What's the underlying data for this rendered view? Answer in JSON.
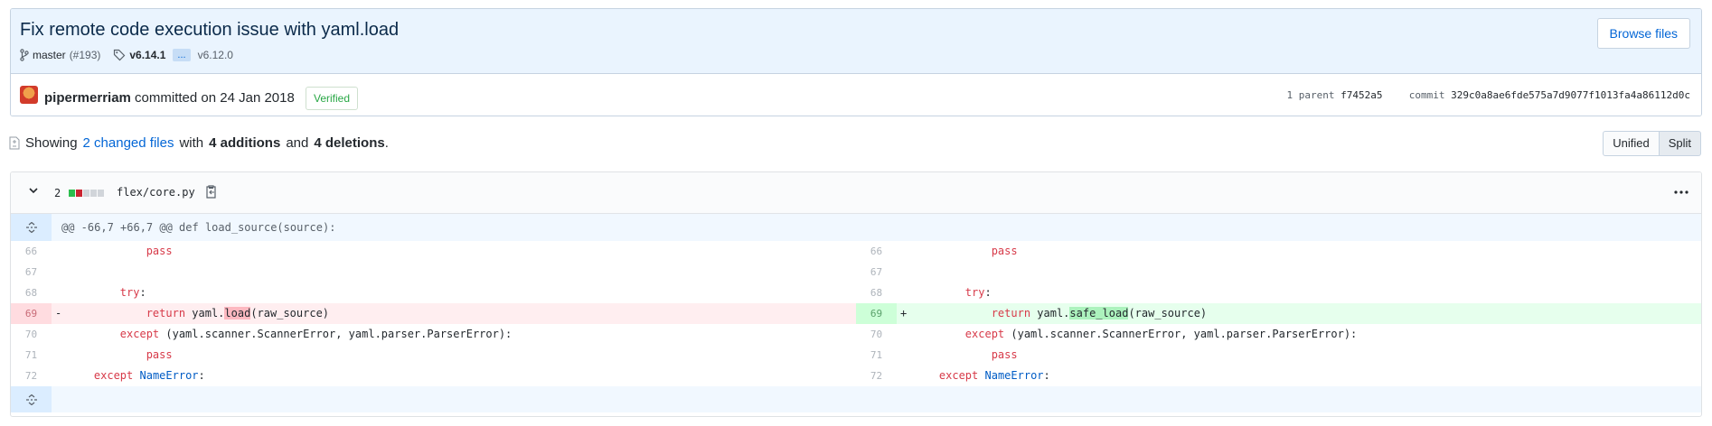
{
  "commit": {
    "title": "Fix remote code execution issue with yaml.load",
    "branch": "master",
    "pr": "(#193)",
    "tag": "v6.14.1",
    "ellipsis": "...",
    "tag_old": "v6.12.0",
    "browse_label": "Browse files",
    "author": "pipermerriam",
    "committed_text": "committed on 24 Jan 2018",
    "verified": "Verified",
    "parent_label": "1 parent",
    "parent_sha": "f7452a5",
    "commit_label": "commit",
    "commit_sha": "329c0a8ae6fde575a7d9077f1013fa4a86112d0c"
  },
  "summary": {
    "showing": "Showing",
    "changed_files": "2 changed files",
    "with": "with",
    "additions": "4 additions",
    "and": "and",
    "deletions": "4 deletions",
    "period": "."
  },
  "view_toggle": {
    "unified": "Unified",
    "split": "Split",
    "selected": "Split"
  },
  "file": {
    "changes": "2",
    "path": "flex/core.py",
    "hunk_header": "@@ -66,7 +66,7 @@ def load_source(source):",
    "colors": {
      "add": "#2cbe4e",
      "del": "#cb2431",
      "neutral": "#d1d5da"
    }
  },
  "diff": {
    "left": [
      {
        "ln": "66",
        "sign": "",
        "pre": "            ",
        "kw": "pass",
        "rest": ""
      },
      {
        "ln": "67",
        "sign": "",
        "pre": "",
        "kw": "",
        "rest": ""
      },
      {
        "ln": "68",
        "sign": "",
        "pre": "        ",
        "kw": "try",
        "rest": ":"
      },
      {
        "ln": "69",
        "sign": "-",
        "pre": "            ",
        "kw": "return",
        "rest": " yaml.",
        "hl": "load",
        "tail": "(raw_source)"
      },
      {
        "ln": "70",
        "sign": "",
        "pre": "        ",
        "kw": "except",
        "rest": " (yaml.scanner.ScannerError, yaml.parser.ParserError):"
      },
      {
        "ln": "71",
        "sign": "",
        "pre": "            ",
        "kw": "pass",
        "rest": ""
      },
      {
        "ln": "72",
        "sign": "",
        "pre": "    ",
        "kw": "except",
        "rest": " ",
        "bi": "NameError",
        "tail": ":"
      }
    ],
    "right": [
      {
        "ln": "66",
        "sign": "",
        "pre": "            ",
        "kw": "pass",
        "rest": ""
      },
      {
        "ln": "67",
        "sign": "",
        "pre": "",
        "kw": "",
        "rest": ""
      },
      {
        "ln": "68",
        "sign": "",
        "pre": "        ",
        "kw": "try",
        "rest": ":"
      },
      {
        "ln": "69",
        "sign": "+",
        "pre": "            ",
        "kw": "return",
        "rest": " yaml.",
        "hl": "safe_load",
        "tail": "(raw_source)"
      },
      {
        "ln": "70",
        "sign": "",
        "pre": "        ",
        "kw": "except",
        "rest": " (yaml.scanner.ScannerError, yaml.parser.ParserError):"
      },
      {
        "ln": "71",
        "sign": "",
        "pre": "            ",
        "kw": "pass",
        "rest": ""
      },
      {
        "ln": "72",
        "sign": "",
        "pre": "    ",
        "kw": "except",
        "rest": " ",
        "bi": "NameError",
        "tail": ":"
      }
    ]
  },
  "icons": [
    "git-branch-icon",
    "tag-icon",
    "avatar",
    "file-diff-icon",
    "chevron-down-icon",
    "clipboard-icon",
    "kebab-icon",
    "unfold-icon"
  ]
}
